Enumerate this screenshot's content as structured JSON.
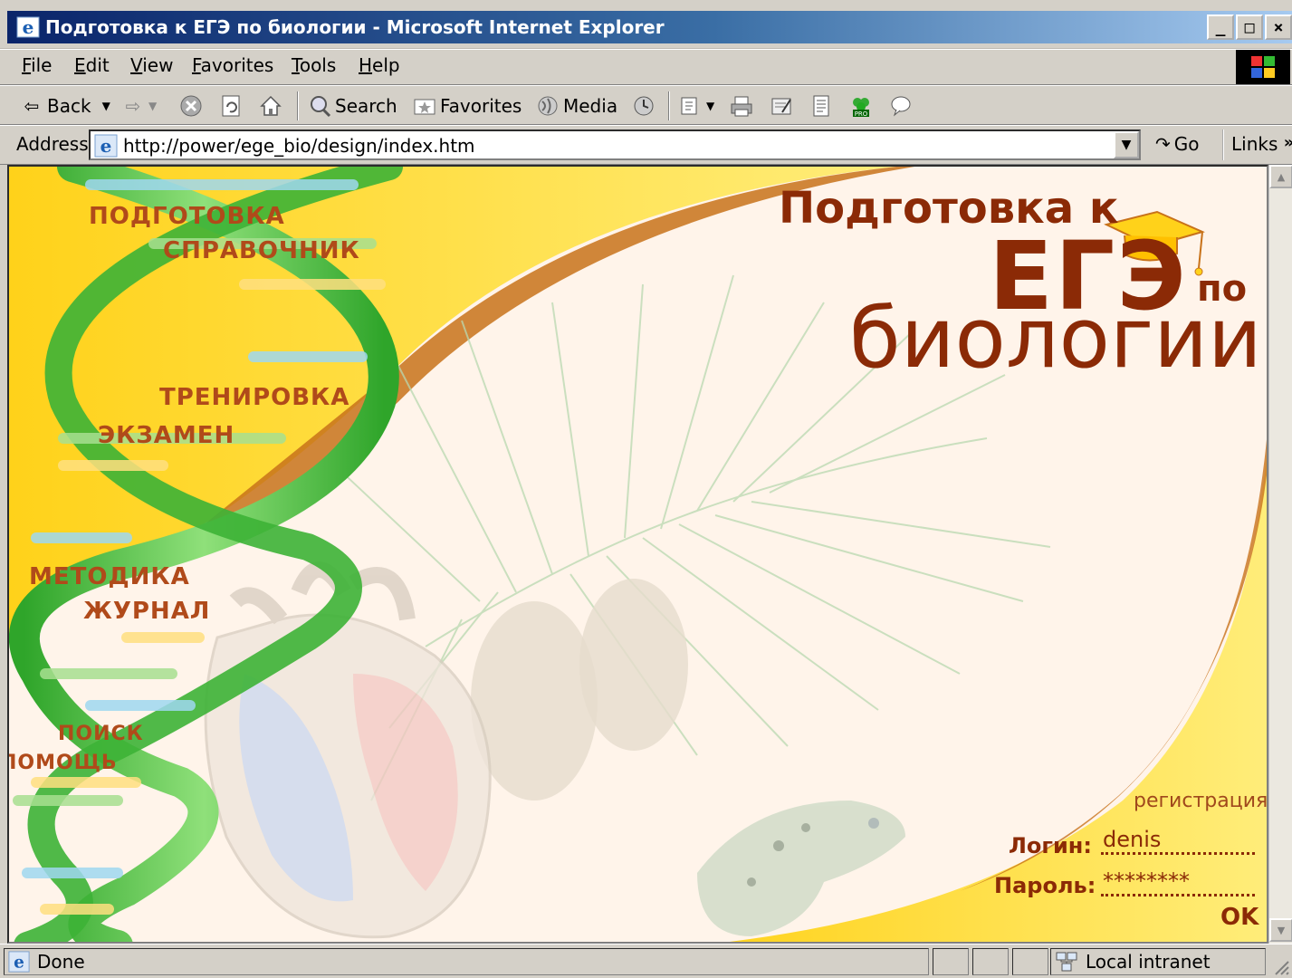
{
  "window": {
    "title": "Подготовка к ЕГЭ по биологии - Microsoft Internet Explorer",
    "minimize": "_",
    "maximize": "□",
    "close": "×"
  },
  "menu": [
    "File",
    "Edit",
    "View",
    "Favorites",
    "Tools",
    "Help"
  ],
  "toolbar": {
    "back": "Back",
    "search": "Search",
    "favorites": "Favorites",
    "media": "Media"
  },
  "address": {
    "label": "Address",
    "url": "http://power/ege_bio/design/index.htm",
    "go": "Go",
    "links": "Links",
    "links_more": "»"
  },
  "page": {
    "nav": [
      "ПОДГОТОВКА",
      "СПРАВОЧНИК",
      "ТРЕНИРОВКА",
      "ЭКЗАМЕН",
      "МЕТОДИКА",
      "ЖУРНАЛ",
      "ПОИСК",
      "ПОМОЩЬ"
    ],
    "brand_line1": "Подготовка к",
    "brand_line2": "ЕГЭ",
    "brand_line3": "по",
    "brand_line4": "биологии",
    "register": "регистрация",
    "login_label": "Логин:",
    "login_value": "denis",
    "password_label": "Пароль:",
    "password_value": "********",
    "ok": "OK"
  },
  "status": {
    "text": "Done",
    "zone": "Local intranet"
  },
  "colors": {
    "accent": "#8b2a06",
    "nav_text": "#b04a1a",
    "helix_green": "#4cbb4a",
    "title_bar_start": "#0a246a",
    "title_bar_end": "#a6caf0"
  }
}
